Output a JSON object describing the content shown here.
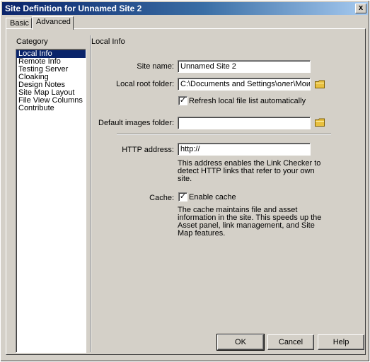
{
  "window": {
    "title": "Site Definition for Unnamed Site 2",
    "close_glyph": "x"
  },
  "tabs": [
    {
      "label": "Basic"
    },
    {
      "label": "Advanced"
    }
  ],
  "category": {
    "label": "Category",
    "items": [
      "Local Info",
      "Remote Info",
      "Testing Server",
      "Cloaking",
      "Design Notes",
      "Site Map Layout",
      "File View Columns",
      "Contribute"
    ],
    "selected_index": 0
  },
  "section_title": "Local Info",
  "form": {
    "site_name_label": "Site name:",
    "site_name_value": "Unnamed Site 2",
    "local_root_label": "Local root folder:",
    "local_root_value": "C:\\Documents and Settings\\олег\\Мои до",
    "refresh_label": "Refresh local file list automatically",
    "refresh_checked": true,
    "default_images_label": "Default images folder:",
    "default_images_value": "",
    "http_label": "HTTP address:",
    "http_value": "http://",
    "http_desc": "This address enables the Link Checker to\ndetect HTTP links that refer to your own\nsite.",
    "cache_label": "Cache:",
    "enable_cache_label": "Enable cache",
    "cache_checked": true,
    "cache_desc": "The cache maintains file and asset\ninformation in the site.  This speeds up the\nAsset panel, link management, and Site\nMap features."
  },
  "buttons": {
    "ok": "OK",
    "cancel": "Cancel",
    "help": "Help"
  },
  "colors": {
    "selection": "#0a246a",
    "folder": "#e8c040",
    "title_start": "#0a246a",
    "title_end": "#a6caf0"
  }
}
